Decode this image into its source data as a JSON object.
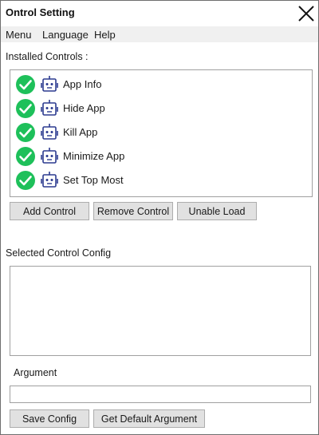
{
  "window": {
    "title": "Ontrol Setting"
  },
  "menu": {
    "items": [
      {
        "label": "Menu"
      },
      {
        "label": "Language"
      },
      {
        "label": "Help"
      }
    ]
  },
  "installed": {
    "heading": "Installed Controls :",
    "items": [
      {
        "label": "App Info",
        "status_icon": "check-circle-icon",
        "type_icon": "robot-icon"
      },
      {
        "label": "Hide App",
        "status_icon": "check-circle-icon",
        "type_icon": "robot-icon"
      },
      {
        "label": "Kill App",
        "status_icon": "check-circle-icon",
        "type_icon": "robot-icon"
      },
      {
        "label": "Minimize App",
        "status_icon": "check-circle-icon",
        "type_icon": "robot-icon"
      },
      {
        "label": "Set Top Most",
        "status_icon": "check-circle-icon",
        "type_icon": "robot-icon"
      }
    ]
  },
  "buttons": {
    "add_control": "Add Control",
    "remove_control": "Remove Control",
    "unable_load": "Unable Load",
    "save_config": "Save Config",
    "get_default_argument": "Get Default Argument"
  },
  "config": {
    "heading": "Selected Control Config",
    "value": ""
  },
  "argument": {
    "label": "Argument",
    "value": ""
  },
  "colors": {
    "check_green": "#1ec05a",
    "robot_blue": "#2b3a8f",
    "menubar_bg": "#f0f0f0",
    "button_bg": "#e1e1e1"
  }
}
